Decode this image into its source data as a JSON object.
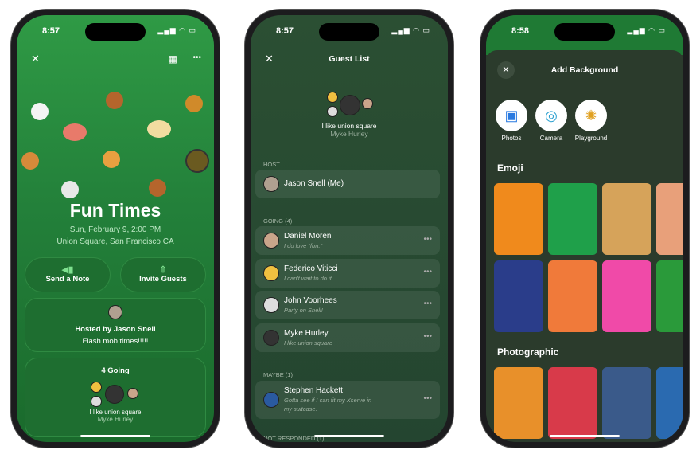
{
  "status": {
    "time1": "8:57",
    "time2": "8:57",
    "time3": "8:58",
    "icons": "▂▄▆ ◠ ▭"
  },
  "event": {
    "close": "✕",
    "more": "•••",
    "calendar": "▦",
    "title": "Fun Times",
    "date": "Sun, February 9, 2:00 PM",
    "location": "Union Square, San Francisco CA",
    "send_note": "Send a Note",
    "invite": "Invite Guests",
    "hosted_by": "Hosted by Jason Snell",
    "host_note": "Flash mob times!!!!!",
    "going_count": "4 Going",
    "featured_note": "I like union square",
    "featured_name": "Myke Hurley"
  },
  "guests": {
    "title": "Guest List",
    "close": "✕",
    "featured_note": "I like union square",
    "featured_name": "Myke Hurley",
    "host_label": "HOST",
    "host": "Jason Snell (Me)",
    "going_label": "GOING (4)",
    "going": [
      {
        "name": "Daniel Moren",
        "note": "I do love “fun.”"
      },
      {
        "name": "Federico Viticci",
        "note": "I can't wait to do it"
      },
      {
        "name": "John Voorhees",
        "note": "Party on Snell!"
      },
      {
        "name": "Myke Hurley",
        "note": "I like union square"
      }
    ],
    "maybe_label": "MAYBE (1)",
    "maybe": {
      "name": "Stephen Hackett",
      "note": "Gotta see if I can fit my Xserve in",
      "note2": "my suitcase."
    },
    "not_responded_label": "NOT RESPONDED (1)",
    "more": "•••"
  },
  "background": {
    "title": "Add Background",
    "close": "✕",
    "sources": [
      {
        "label": "Photos",
        "icon": "▣"
      },
      {
        "label": "Camera",
        "icon": "◎"
      },
      {
        "label": "Playground",
        "icon": "✺"
      }
    ],
    "emoji_label": "Emoji",
    "photo_label": "Photographic",
    "emoji_colors": [
      "#f08a1c",
      "#1fa04a",
      "#d6a35a",
      "#e8a07a",
      "#2a3d8a",
      "#f07a3a",
      "#f04aa8",
      "#2a9a3a"
    ],
    "photo_colors": [
      "#e8902a",
      "#d83a4a",
      "#3a5a8a",
      "#2a6ab0"
    ]
  }
}
